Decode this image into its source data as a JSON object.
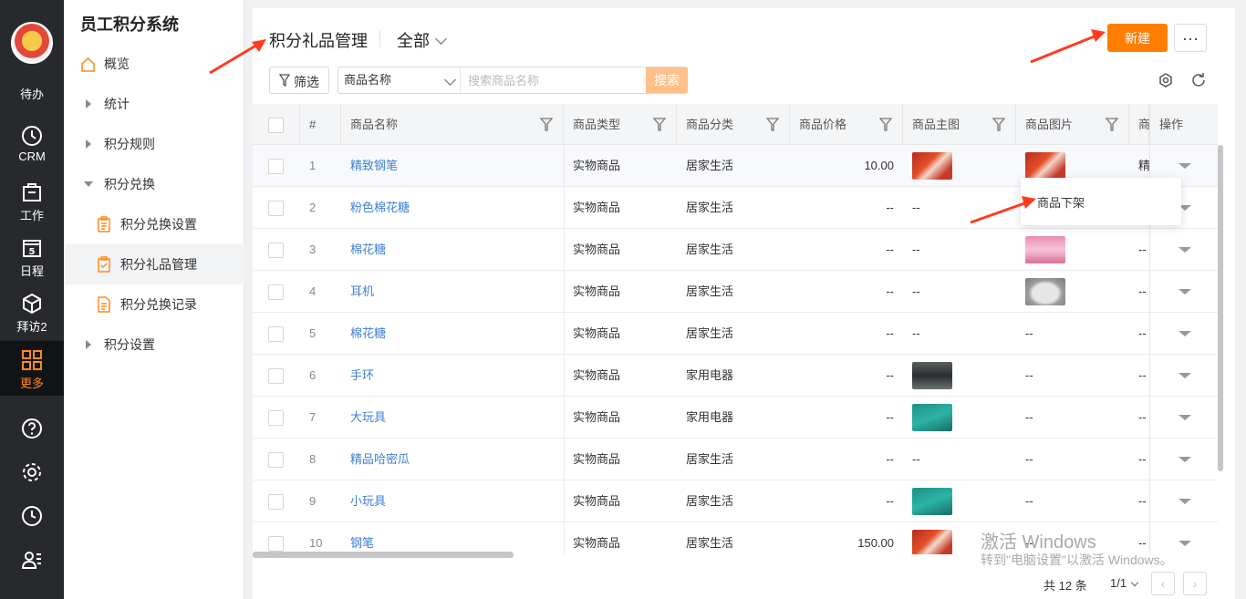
{
  "app": {
    "title": "员工积分系统"
  },
  "rail": {
    "items": [
      {
        "label": "待办",
        "icon": "todo-icon"
      },
      {
        "label": "CRM",
        "icon": "clock-icon"
      },
      {
        "label": "工作",
        "icon": "briefcase-icon"
      },
      {
        "label": "日程",
        "icon": "calendar-icon",
        "badge": "5"
      },
      {
        "label": "拜访2",
        "icon": "cube-icon"
      },
      {
        "label": "更多",
        "icon": "grid-icon",
        "active": true
      }
    ],
    "bottom_icons": [
      "help-icon",
      "settings-icon",
      "history-icon",
      "contacts-icon"
    ]
  },
  "sidebar": {
    "items": [
      {
        "label": "概览"
      },
      {
        "label": "统计"
      },
      {
        "label": "积分规则"
      },
      {
        "label": "积分兑换"
      },
      {
        "label": "积分兑换设置"
      },
      {
        "label": "积分礼品管理"
      },
      {
        "label": "积分兑换记录"
      },
      {
        "label": "积分设置"
      }
    ]
  },
  "header": {
    "title": "积分礼品管理",
    "view": "全部",
    "new_button": "新建",
    "more_button": "···"
  },
  "toolbar": {
    "filter_label": "筛选",
    "search_field": "商品名称",
    "search_placeholder": "搜索商品名称",
    "search_button": "搜索"
  },
  "table": {
    "columns": [
      "#",
      "商品名称",
      "商品类型",
      "商品分类",
      "商品价格",
      "商品主图",
      "商品图片",
      "商",
      "操作"
    ],
    "rows": [
      {
        "n": "1",
        "name": "精致钢笔",
        "type": "实物商品",
        "cat": "居家生活",
        "price": "10.00",
        "main": "red",
        "pic": "red",
        "extra": "精"
      },
      {
        "n": "2",
        "name": "粉色棉花糖",
        "type": "实物商品",
        "cat": "居家生活",
        "price": "--",
        "main": "--",
        "pic": "",
        "extra": ""
      },
      {
        "n": "3",
        "name": "棉花糖",
        "type": "实物商品",
        "cat": "居家生活",
        "price": "--",
        "main": "--",
        "pic": "pink",
        "extra": "--"
      },
      {
        "n": "4",
        "name": "耳机",
        "type": "实物商品",
        "cat": "居家生活",
        "price": "--",
        "main": "--",
        "pic": "gray",
        "extra": "--"
      },
      {
        "n": "5",
        "name": "棉花糖",
        "type": "实物商品",
        "cat": "居家生活",
        "price": "--",
        "main": "--",
        "pic": "--",
        "extra": "--"
      },
      {
        "n": "6",
        "name": "手环",
        "type": "实物商品",
        "cat": "家用电器",
        "price": "--",
        "main": "dark",
        "pic": "--",
        "extra": "--"
      },
      {
        "n": "7",
        "name": "大玩具",
        "type": "实物商品",
        "cat": "家用电器",
        "price": "--",
        "main": "teal",
        "pic": "--",
        "extra": "--"
      },
      {
        "n": "8",
        "name": "精品哈密瓜",
        "type": "实物商品",
        "cat": "居家生活",
        "price": "--",
        "main": "--",
        "pic": "--",
        "extra": "--"
      },
      {
        "n": "9",
        "name": "小玩具",
        "type": "实物商品",
        "cat": "居家生活",
        "price": "--",
        "main": "teal",
        "pic": "--",
        "extra": "--"
      },
      {
        "n": "10",
        "name": "钢笔",
        "type": "实物商品",
        "cat": "居家生活",
        "price": "150.00",
        "main": "red",
        "pic": "--",
        "extra": "--"
      }
    ]
  },
  "popup": {
    "label": "商品下架"
  },
  "pagination": {
    "total": "共 12 条",
    "page": "1/1"
  },
  "watermark": {
    "line1": "激活 Windows",
    "line2": "转到\"电脑设置\"以激活 Windows。"
  },
  "colors": {
    "accent": "#ff7e00",
    "link": "#3f7fd6",
    "rail": "#27292d",
    "annotation": "#ff3b1f"
  }
}
